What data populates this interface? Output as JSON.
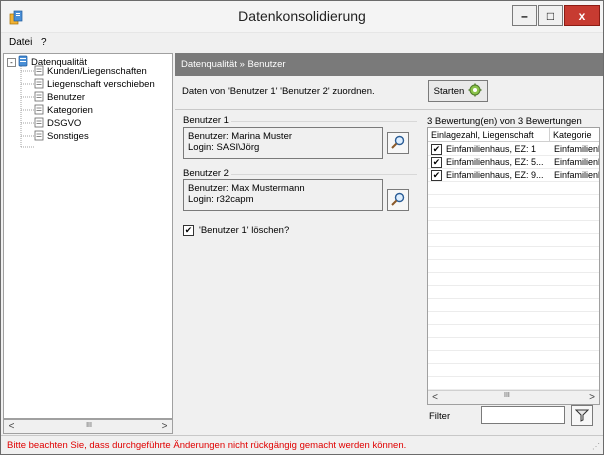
{
  "window": {
    "title": "Datenkonsolidierung",
    "minimize_symbol": "–",
    "maximize_symbol": "□",
    "close_symbol": "x"
  },
  "menu": {
    "items": [
      "Datei",
      "?"
    ]
  },
  "tree": {
    "root": "Datenqualität",
    "children": [
      "Kunden/Liegenschaften",
      "Liegenschaft verschieben",
      "Benutzer",
      "Kategorien",
      "DSGVO",
      "Sonstiges"
    ]
  },
  "tree_scroll": {
    "left": "<",
    "right": ">",
    "thumb": "III"
  },
  "panel": {
    "breadcrumb": "Datenqualität » Benutzer",
    "description": "Daten von 'Benutzer 1' 'Benutzer 2' zuordnen.",
    "start_label": "Starten",
    "user1": {
      "title": "Benutzer 1",
      "name": "Benutzer: Marina Muster",
      "login": "Login: SASI\\Jörg"
    },
    "user2": {
      "title": "Benutzer 2",
      "name": "Benutzer: Max Mustermann",
      "login": "Login: r32capm"
    },
    "delete_label": "'Benutzer 1' löschen?",
    "delete_checked": true
  },
  "ratings": {
    "title": "3 Bewertung(en) von 3 Bewertungen",
    "columns": [
      "Einlagezahl, Liegenschaft",
      "Kategorie"
    ],
    "rows": [
      {
        "name": "Einfamilienhaus, EZ: 1",
        "category": "Einfamilienhaus",
        "checked": true
      },
      {
        "name": "Einfamilienhaus, EZ: 5...",
        "category": "Einfamilienhaus",
        "checked": true
      },
      {
        "name": "Einfamilienhaus, EZ: 9...",
        "category": "Einfamilienhaus",
        "checked": true
      }
    ],
    "scroll_left": "<",
    "scroll_right": ">",
    "scroll_thumb": "III"
  },
  "filter": {
    "label": "Filter",
    "value": ""
  },
  "status": {
    "message": "Bitte beachten Sie, dass durchgeführte Änderungen nicht rückgängig gemacht werden können."
  },
  "colors": {
    "status_text": "#e00000",
    "panel_header": "#7a7a7a",
    "close_button": "#c73b31"
  },
  "icons": [
    "app-icon",
    "server-icon",
    "document-icon",
    "search-icon",
    "gear-icon",
    "checkmark-icon",
    "filter-icon"
  ]
}
